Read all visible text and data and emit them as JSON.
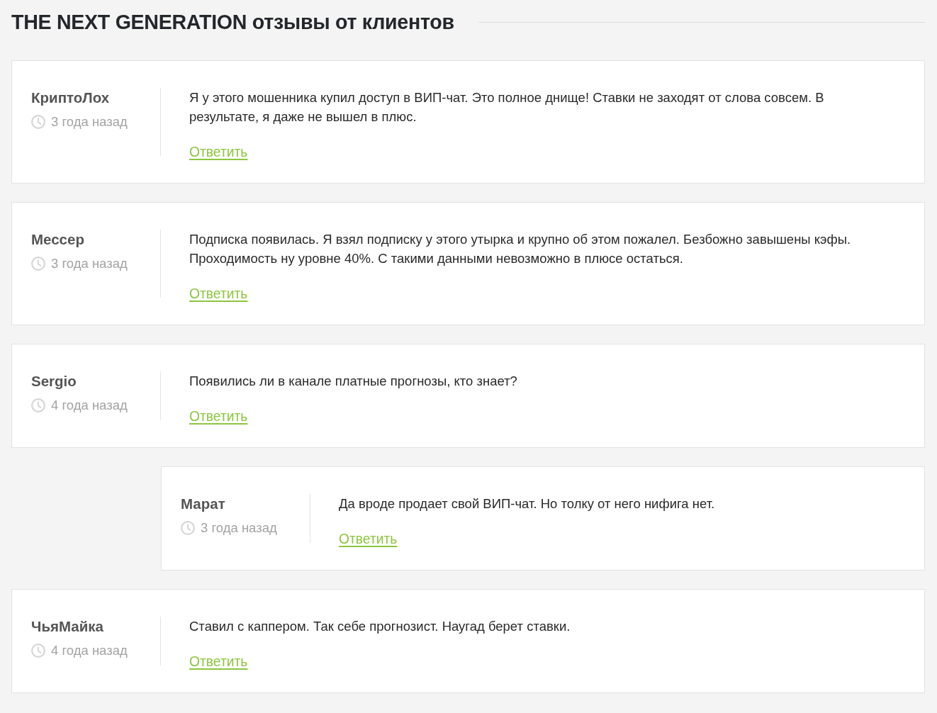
{
  "header": {
    "title": "THE NEXT GENERATION отзывы от клиентов"
  },
  "comments": [
    {
      "author": "КриптоЛох",
      "time": "3 года назад",
      "text": "Я у этого мошенника купил доступ в ВИП-чат. Это полное днище! Ставки не заходят от слова совсем. В результате, я даже не вышел в плюс.",
      "reply_label": "Ответить"
    },
    {
      "author": "Мессер",
      "time": "3 года назад",
      "text": "Подписка появилась. Я взял подписку у этого утырка и крупно об этом пожалел. Безбожно завышены кэфы. Проходимость ну уровне 40%. С такими данными невозможно в плюсе остаться.",
      "reply_label": "Ответить"
    },
    {
      "author": "Sergio",
      "time": "4 года назад",
      "text": "Появились ли в канале платные прогнозы, кто знает?",
      "reply_label": "Ответить",
      "children": [
        {
          "author": "Марат",
          "time": "3 года назад",
          "text": "Да вроде продает свой ВИП-чат. Но толку от него нифига нет.",
          "reply_label": "Ответить"
        }
      ]
    },
    {
      "author": "ЧьяМайка",
      "time": "4 года назад",
      "text": "Ставил с каппером. Так себе прогнозист. Наугад берет ставки.",
      "reply_label": "Ответить"
    }
  ]
}
